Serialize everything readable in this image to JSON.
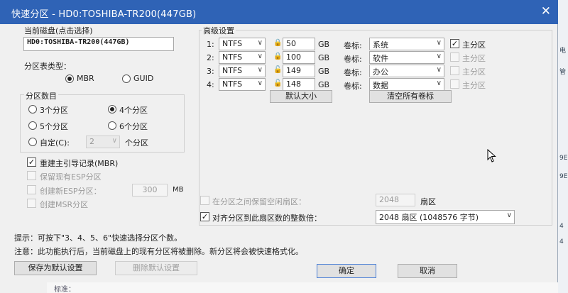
{
  "window": {
    "title": "快速分区 - HD0:TOSHIBA-TR200(447GB)"
  },
  "disk": {
    "label": "当前磁盘(点击选择)",
    "value": "HD0:TOSHIBA-TR200(447GB)"
  },
  "partition_table": {
    "label": "分区表类型：",
    "options": [
      "MBR",
      "GUID"
    ],
    "selected": "MBR"
  },
  "partition_count": {
    "label": "分区数目",
    "options": [
      "3个分区",
      "4个分区",
      "5个分区",
      "6个分区"
    ],
    "selected": "4个分区",
    "custom_label": "自定(C):",
    "custom_value": "2",
    "custom_suffix": "个分区"
  },
  "options": {
    "rebuild_mbr": "重建主引导记录(MBR)",
    "keep_esp": "保留现有ESP分区",
    "create_esp": "创建新ESP分区：",
    "esp_size": "300",
    "esp_unit": "MB",
    "create_msr": "创建MSR分区"
  },
  "advanced": {
    "label": "高级设置",
    "rows": [
      {
        "index": "1:",
        "fs": "NTFS",
        "size": "50",
        "unit": "GB",
        "vol_label": "卷标:",
        "volume": "系统",
        "primary_checked": true
      },
      {
        "index": "2:",
        "fs": "NTFS",
        "size": "100",
        "unit": "GB",
        "vol_label": "卷标:",
        "volume": "软件",
        "primary_checked": false
      },
      {
        "index": "3:",
        "fs": "NTFS",
        "size": "149",
        "unit": "GB",
        "vol_label": "卷标:",
        "volume": "办公",
        "primary_checked": false
      },
      {
        "index": "4:",
        "fs": "NTFS",
        "size": "148",
        "unit": "GB",
        "vol_label": "卷标:",
        "volume": "数据",
        "primary_checked": false
      }
    ],
    "primary_label": "主分区",
    "default_size_button": "默认大小",
    "clear_labels_button": "清空所有卷标"
  },
  "alignment": {
    "keep_free_label": "在分区之间保留空闲扇区：",
    "keep_free_value": "2048",
    "keep_free_unit": "扇区",
    "align_label": "对齐分区到此扇区数的整数倍：",
    "align_value": "2048 扇区 (1048576 字节)"
  },
  "notes": {
    "hint": "提示：可按下\"3、4、5、6\"快速选择分区个数。",
    "warning": "注意：此功能执行后，当前磁盘上的现有分区将被删除。新分区将会被快速格式化。"
  },
  "buttons": {
    "save_default": "保存为默认设置",
    "delete_default": "删除默认设置",
    "ok": "确定",
    "cancel": "取消"
  },
  "background": {
    "bottom_text": "标准：",
    "right_chars": [
      "电",
      "管",
      "9E",
      "9E",
      "4",
      "4"
    ]
  }
}
